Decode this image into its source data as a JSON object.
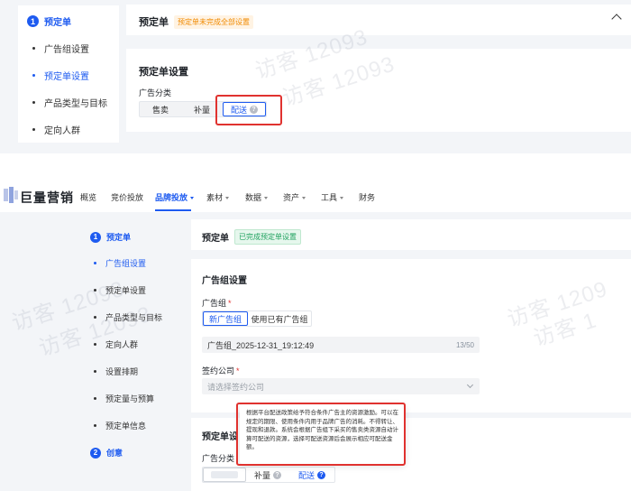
{
  "top": {
    "sidebar": {
      "step": "1",
      "step_title": "预定单",
      "items": [
        "广告组设置",
        "预定单设置",
        "产品类型与目标",
        "定向人群"
      ]
    },
    "card1": {
      "title": "预定单",
      "badge": "预定单未完成全部设置"
    },
    "card2": {
      "title": "预定单设置",
      "field_label": "广告分类",
      "options": [
        "售卖",
        "补量",
        "配送"
      ],
      "help_icon": "question-circle-icon"
    }
  },
  "app": {
    "brand": "巨量营销",
    "nav": [
      {
        "label": "概览",
        "caret": false
      },
      {
        "label": "竞价投放",
        "caret": false
      },
      {
        "label": "品牌投放",
        "caret": true,
        "active": true
      },
      {
        "label": "素材",
        "caret": true
      },
      {
        "label": "数据",
        "caret": true
      },
      {
        "label": "资产",
        "caret": true
      },
      {
        "label": "工具",
        "caret": true
      },
      {
        "label": "财务",
        "caret": false
      }
    ],
    "sidebar": {
      "step1": "1",
      "step1_title": "预定单",
      "items": [
        "广告组设置",
        "预定单设置",
        "产品类型与目标",
        "定向人群",
        "设置排期",
        "预定量与预算",
        "预定单信息"
      ],
      "step2": "2",
      "step2_title": "创意"
    },
    "order_card": {
      "title": "预定单",
      "badge": "已完成预定单设置"
    },
    "group_card": {
      "title": "广告组设置",
      "group_label": "广告组",
      "group_options": [
        "新广告组",
        "使用已有广告组"
      ],
      "group_name": "广告组_2025-12-31_19:12:49",
      "group_counter": "13/50",
      "company_label": "签约公司",
      "company_placeholder": "请选择签约公司",
      "required_mark": "*"
    },
    "settings_card": {
      "title": "预定单设",
      "field_label": "广告分类",
      "options": [
        "补量",
        "配送"
      ]
    },
    "tooltip": "根据平台配送政策给予符合条件广告主的资源激励。可以在规定的期限、使用条件内用于品牌广告的消耗。不得转让、提现和退款。系统会根据广告组下采买的售卖类资源自动计算可配送的资源，选择可配送资源后会展示相应可配送金额。"
  },
  "watermark": [
    "访客 12093",
    "访客 12093",
    "访客 1209",
    "访客 1"
  ],
  "colors": {
    "accent": "#1e5bf0",
    "highlight": "#e0322f",
    "warning": "#f08a00",
    "success": "#20a25f"
  }
}
